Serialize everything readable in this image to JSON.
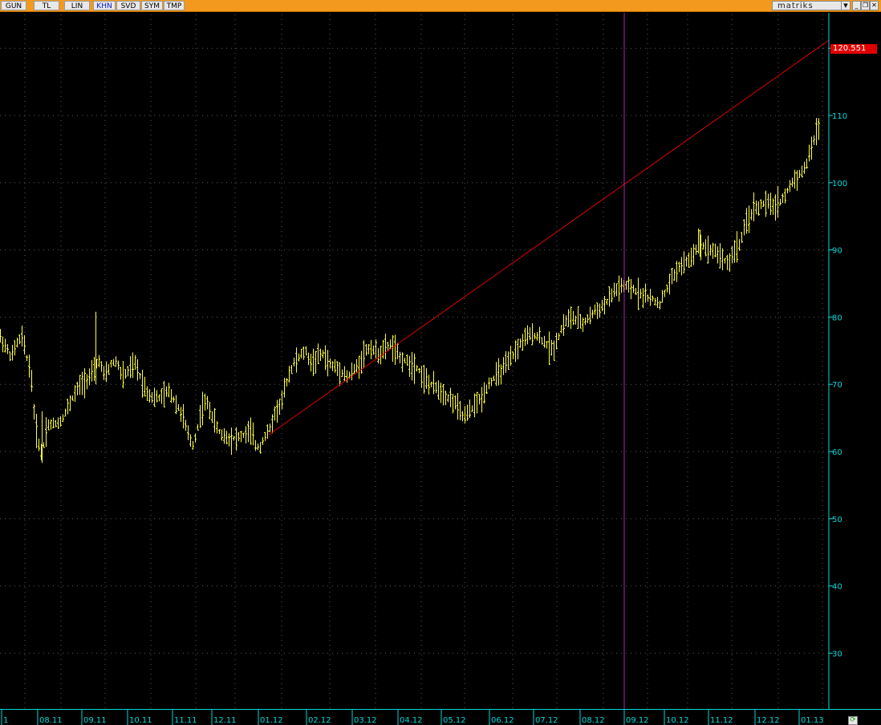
{
  "toolbar": {
    "buttons": [
      "GUN",
      "TL",
      "LIN",
      "KHN",
      "SVD",
      "SYM",
      "TMP"
    ],
    "active": "KHN",
    "brand": "matriks",
    "accent": "#f39a1e"
  },
  "window_controls": [
    "minimize",
    "restore",
    "close"
  ],
  "price_marker": {
    "label": "120.551",
    "color": "#e00000"
  },
  "chart_data": {
    "type": "bar",
    "title": "",
    "y_ticks": [
      30,
      40,
      50,
      60,
      70,
      80,
      90,
      100,
      110
    ],
    "ylim": [
      22,
      125
    ],
    "x_labels": [
      "1",
      "08.11",
      "09.11",
      "10.11",
      "11.11",
      "12.11",
      "01.12",
      "02.12",
      "03.12",
      "04.12",
      "05.12",
      "06.12",
      "07.12",
      "08.12",
      "09.12",
      "10.12",
      "11.12",
      "12.12",
      "01.13"
    ],
    "price_path": [
      [
        0,
        77
      ],
      [
        14,
        74
      ],
      [
        20,
        76
      ],
      [
        27,
        77
      ],
      [
        33,
        74
      ],
      [
        38,
        72
      ],
      [
        42,
        66
      ],
      [
        46,
        62
      ],
      [
        52,
        59.5
      ],
      [
        58,
        64
      ],
      [
        65,
        64
      ],
      [
        75,
        64.5
      ],
      [
        82,
        66
      ],
      [
        90,
        68
      ],
      [
        100,
        70
      ],
      [
        110,
        71
      ],
      [
        118,
        72
      ],
      [
        122,
        74
      ],
      [
        130,
        71
      ],
      [
        138,
        73
      ],
      [
        145,
        73.5
      ],
      [
        152,
        71
      ],
      [
        160,
        72
      ],
      [
        168,
        73
      ],
      [
        175,
        71
      ],
      [
        182,
        69
      ],
      [
        190,
        68
      ],
      [
        200,
        68
      ],
      [
        210,
        69
      ],
      [
        220,
        67
      ],
      [
        228,
        65
      ],
      [
        235,
        62
      ],
      [
        240,
        61
      ],
      [
        245,
        63
      ],
      [
        250,
        66
      ],
      [
        256,
        67.5
      ],
      [
        262,
        66
      ],
      [
        268,
        64
      ],
      [
        275,
        62.5
      ],
      [
        285,
        62
      ],
      [
        295,
        62
      ],
      [
        305,
        62.5
      ],
      [
        312,
        63
      ],
      [
        318,
        61
      ],
      [
        323,
        60.5
      ],
      [
        328,
        62
      ],
      [
        335,
        63
      ],
      [
        343,
        66
      ],
      [
        350,
        67
      ],
      [
        358,
        71
      ],
      [
        365,
        73
      ],
      [
        372,
        74
      ],
      [
        380,
        75
      ],
      [
        388,
        73
      ],
      [
        395,
        74
      ],
      [
        402,
        74.5
      ],
      [
        410,
        73
      ],
      [
        418,
        72.5
      ],
      [
        425,
        72
      ],
      [
        433,
        71
      ],
      [
        440,
        72
      ],
      [
        447,
        73
      ],
      [
        455,
        75
      ],
      [
        462,
        75.5
      ],
      [
        470,
        74.5
      ],
      [
        478,
        75
      ],
      [
        485,
        76
      ],
      [
        490,
        75.5
      ],
      [
        497,
        74
      ],
      [
        505,
        73.5
      ],
      [
        512,
        73
      ],
      [
        520,
        72.5
      ],
      [
        527,
        71
      ],
      [
        535,
        70
      ],
      [
        543,
        69.5
      ],
      [
        550,
        69
      ],
      [
        558,
        68
      ],
      [
        565,
        67.5
      ],
      [
        572,
        66
      ],
      [
        578,
        65
      ],
      [
        585,
        66
      ],
      [
        592,
        67
      ],
      [
        600,
        68
      ],
      [
        608,
        70
      ],
      [
        616,
        71
      ],
      [
        624,
        72
      ],
      [
        632,
        73
      ],
      [
        640,
        74.5
      ],
      [
        648,
        76
      ],
      [
        656,
        77
      ],
      [
        664,
        77.5
      ],
      [
        672,
        77
      ],
      [
        680,
        76
      ],
      [
        688,
        75
      ],
      [
        695,
        77
      ],
      [
        702,
        79
      ],
      [
        710,
        80
      ],
      [
        718,
        79.5
      ],
      [
        726,
        79
      ],
      [
        734,
        80
      ],
      [
        742,
        81
      ],
      [
        750,
        81.5
      ],
      [
        758,
        82.5
      ],
      [
        766,
        84
      ],
      [
        774,
        84.5
      ],
      [
        782,
        84.5
      ],
      [
        790,
        84
      ],
      [
        798,
        83.5
      ],
      [
        806,
        83
      ],
      [
        814,
        82.5
      ],
      [
        822,
        82
      ],
      [
        830,
        84
      ],
      [
        838,
        86
      ],
      [
        846,
        87.5
      ],
      [
        854,
        88
      ],
      [
        862,
        89
      ],
      [
        870,
        91
      ],
      [
        878,
        90.5
      ],
      [
        886,
        90
      ],
      [
        894,
        89.5
      ],
      [
        902,
        88.5
      ],
      [
        908,
        88
      ],
      [
        915,
        90
      ],
      [
        922,
        91
      ],
      [
        930,
        94
      ],
      [
        938,
        96
      ],
      [
        946,
        96.5
      ],
      [
        954,
        97
      ],
      [
        962,
        96.5
      ],
      [
        970,
        97
      ],
      [
        978,
        98
      ],
      [
        986,
        100
      ],
      [
        994,
        101
      ],
      [
        1002,
        102
      ],
      [
        1008,
        104
      ],
      [
        1013,
        106
      ],
      [
        1018,
        108
      ],
      [
        1022,
        108.5
      ]
    ],
    "trend_line": {
      "x0": 335,
      "y0": 62.5,
      "x1": 1033,
      "y1": 121.2,
      "color": "#e00000"
    },
    "vertical_marker": {
      "x": 778,
      "color": "#b020b0"
    },
    "bar_color": "#ffff40",
    "axis_color": "#00d8d8",
    "grid": "dotted"
  }
}
